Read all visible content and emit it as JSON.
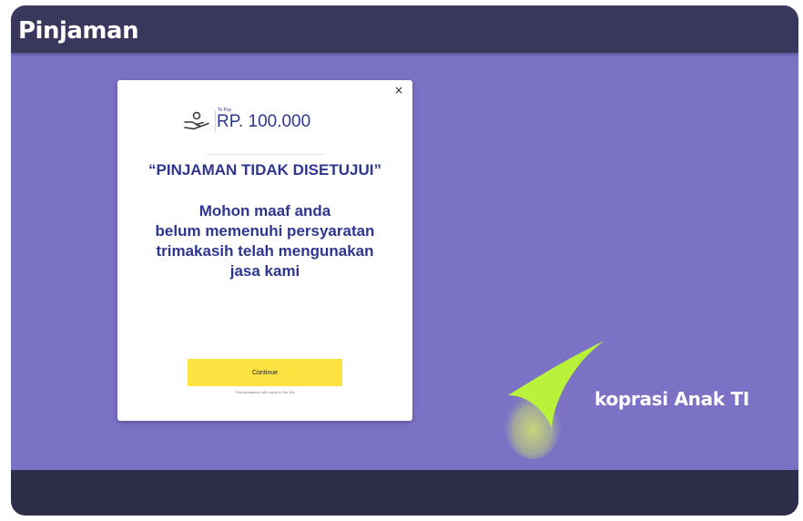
{
  "header": {
    "title": "Pinjaman"
  },
  "modal": {
    "close_label": "×",
    "to_pay_label": "To Pay",
    "amount": "RP. 100.000",
    "status_title": "“PINJAMAN TIDAK DISETUJUI”",
    "message_lines": [
      "Mohon maaf anda",
      "belum memenuhi persyaratan",
      "trimakasih telah mengunakan",
      "jasa kami"
    ],
    "continue_label": "Continue",
    "expire_note": "This transaction will expire in 5m 59s"
  },
  "brand": {
    "text": "koprasi Anak TI"
  },
  "colors": {
    "background": "#7b72c6",
    "header": "#39375b",
    "footer": "#2e2d4a",
    "accent_text": "#2f3691",
    "button": "#fde242",
    "logo_green": "#b8f23a"
  },
  "icons": {
    "pay": "hand-coin-icon",
    "close": "close-icon",
    "logo": "checkmark-swoosh-logo"
  }
}
